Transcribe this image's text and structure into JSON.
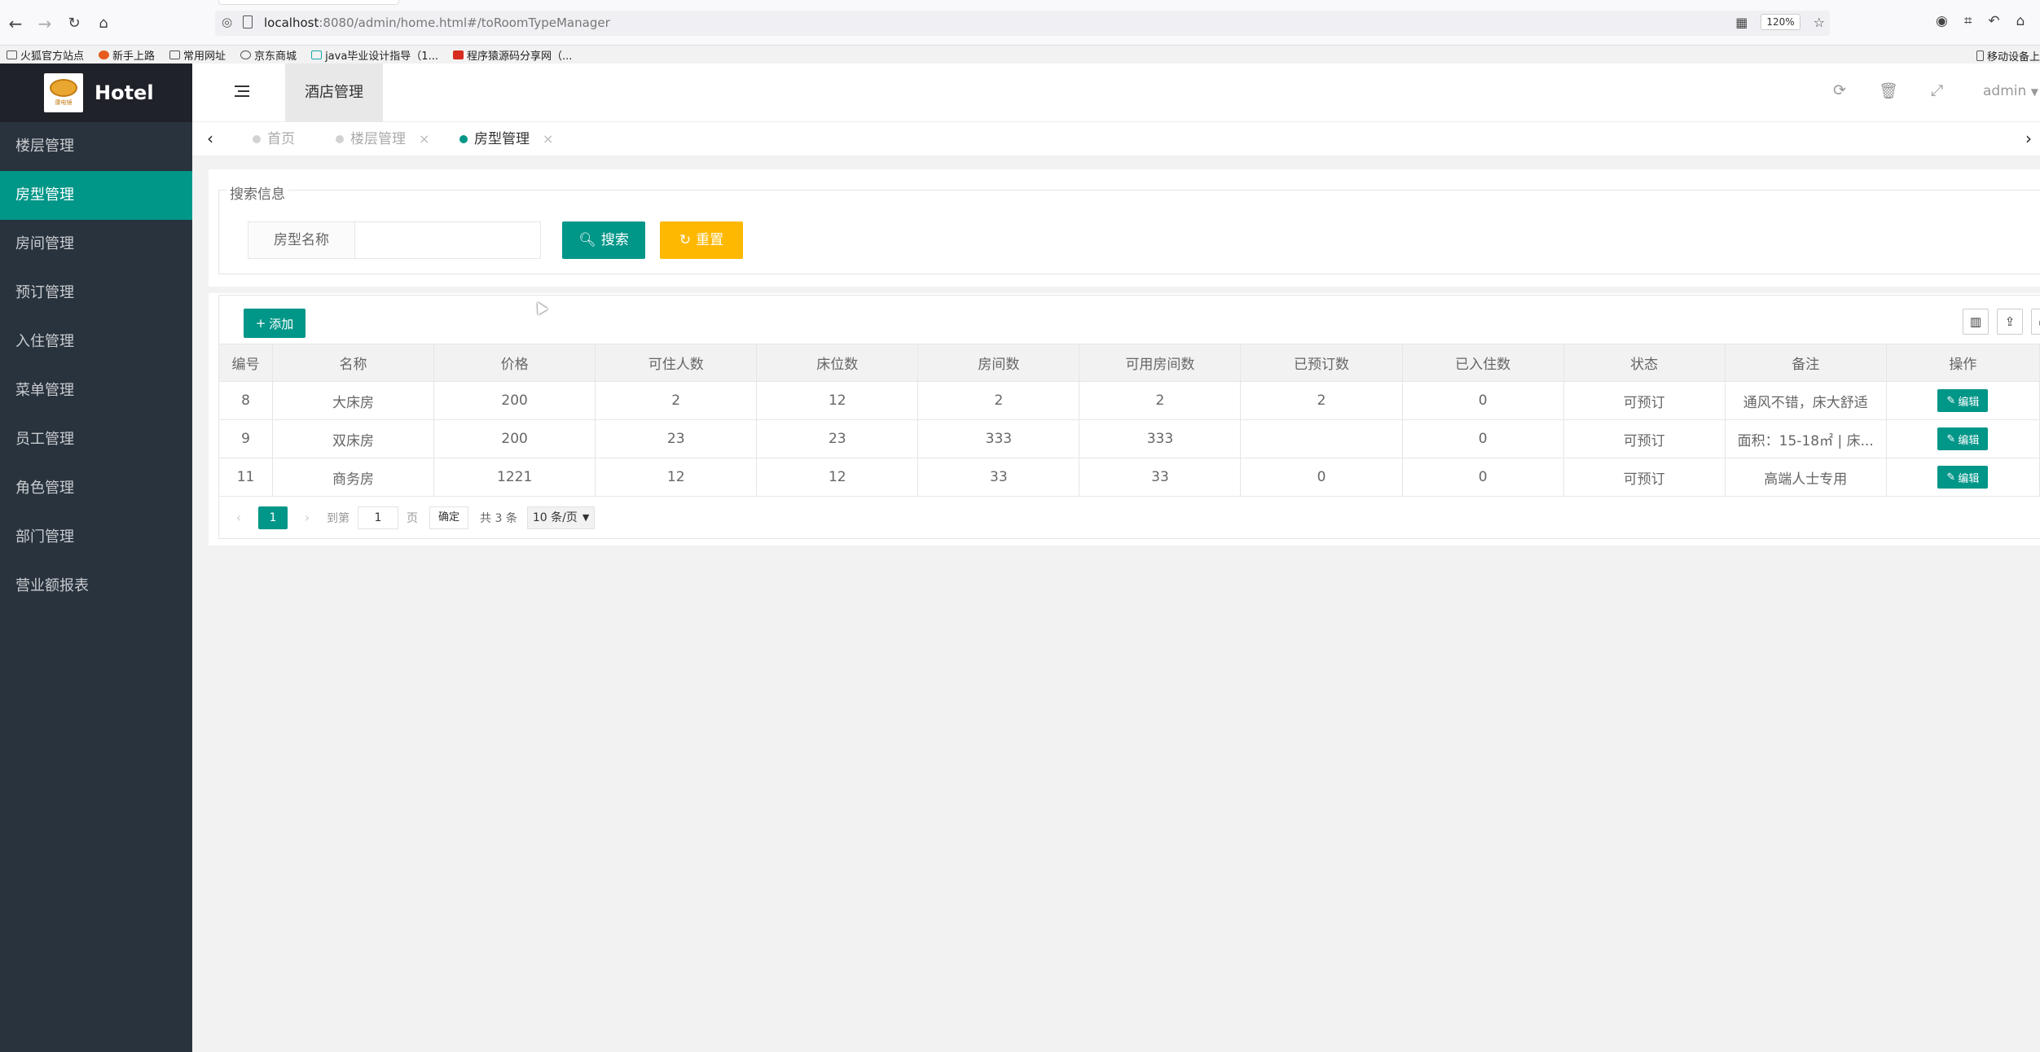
{
  "browser": {
    "url_host": "localhost",
    "url_rest": ":8080/admin/home.html#/toRoomTypeManager",
    "zoom": "120%",
    "bookmarks": [
      "火狐官方站点",
      "新手上路",
      "常用网址",
      "京东商城",
      "java毕业设计指导（1...",
      "程序猿源码分享网（..."
    ],
    "bookmarks_right": "移动设备上"
  },
  "sidebar": {
    "logo_text": "Hotel",
    "logo_img_text": "康电镜",
    "items": [
      {
        "label": "楼层管理"
      },
      {
        "label": "房型管理"
      },
      {
        "label": "房间管理"
      },
      {
        "label": "预订管理"
      },
      {
        "label": "入住管理"
      },
      {
        "label": "菜单管理"
      },
      {
        "label": "员工管理"
      },
      {
        "label": "角色管理"
      },
      {
        "label": "部门管理"
      },
      {
        "label": "营业额报表"
      }
    ]
  },
  "header": {
    "tab_label": "酒店管理",
    "user": "admin"
  },
  "tabs": [
    {
      "label": "首页"
    },
    {
      "label": "楼层管理"
    },
    {
      "label": "房型管理"
    }
  ],
  "search": {
    "legend": "搜索信息",
    "field_label": "房型名称",
    "field_value": "",
    "search_label": "搜索",
    "reset_label": "重置"
  },
  "table": {
    "add_label": "添加",
    "columns": [
      "编号",
      "名称",
      "价格",
      "可住人数",
      "床位数",
      "房间数",
      "可用房间数",
      "已预订数",
      "已入住数",
      "状态",
      "备注",
      "操作"
    ],
    "rows": [
      [
        "8",
        "大床房",
        "200",
        "2",
        "12",
        "2",
        "2",
        "2",
        "0",
        "可预订",
        "通风不错，床大舒适"
      ],
      [
        "9",
        "双床房",
        "200",
        "23",
        "23",
        "333",
        "333",
        "",
        "0",
        "可预订",
        "面积：15-18㎡ | 床..."
      ],
      [
        "11",
        "商务房",
        "1221",
        "12",
        "12",
        "33",
        "33",
        "0",
        "0",
        "可预订",
        "高端人士专用"
      ]
    ],
    "edit_label": "编辑"
  },
  "pager": {
    "current_page": "1",
    "goto_label": "到第",
    "goto_value": "1",
    "page_unit": "页",
    "confirm_label": "确定",
    "total": "共 3 条",
    "per_page": "10 条/页"
  }
}
